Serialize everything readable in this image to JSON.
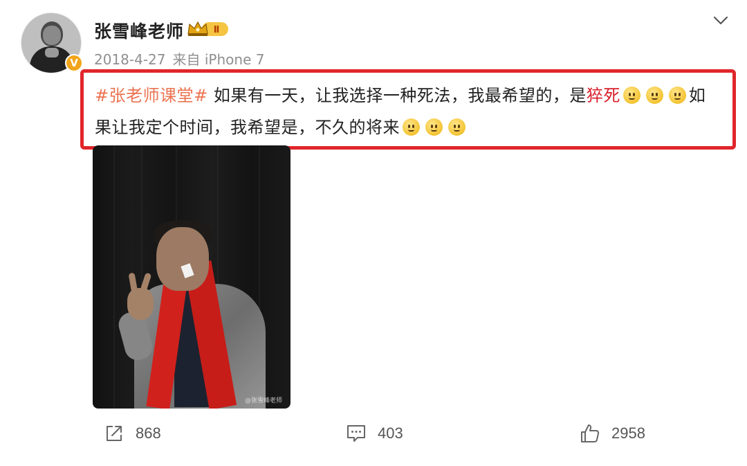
{
  "user": {
    "name": "张雪峰老师",
    "verified_badge": "V",
    "crown_icon": "crown-vip-icon",
    "vip_level": "Ⅱ"
  },
  "meta": {
    "date": "2018-4-27",
    "source": "来自 iPhone 7"
  },
  "post": {
    "hashtag": "#张老师课堂#",
    "text_1": " 如果有一天，让我选择一种死法，我最希望的，是",
    "highlight": "猝死",
    "text_2": "如果让我定个时间，我希望是，不久的将来",
    "emoji_name": "smile-emoji",
    "highlight_box_color": "#e0262b"
  },
  "image": {
    "watermark": "@张雪峰老师"
  },
  "actions": {
    "repost_count": "868",
    "comment_count": "403",
    "like_count": "2958"
  }
}
